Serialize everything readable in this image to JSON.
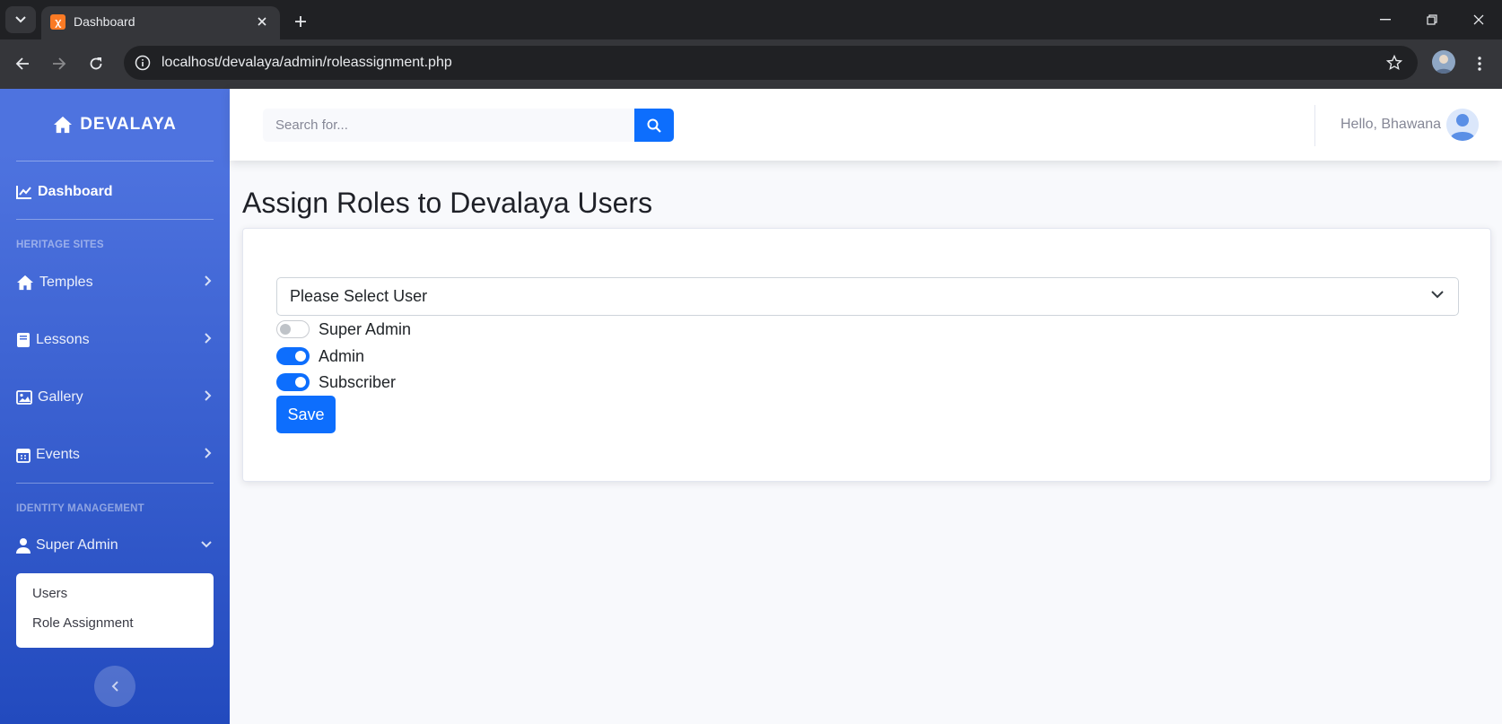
{
  "browser": {
    "tab_title": "Dashboard",
    "url": "localhost/devalaya/admin/roleassignment.php"
  },
  "sidebar": {
    "brand": "DEVALAYA",
    "dashboard_label": "Dashboard",
    "heritage_heading": "HERITAGE SITES",
    "items": [
      {
        "label": "Temples"
      },
      {
        "label": "Lessons"
      },
      {
        "label": "Gallery"
      },
      {
        "label": "Events"
      }
    ],
    "identity_heading": "IDENTITY MANAGEMENT",
    "super_admin_label": "Super Admin",
    "submenu": [
      {
        "label": "Users"
      },
      {
        "label": "Role Assignment"
      }
    ]
  },
  "topbar": {
    "search_placeholder": "Search for...",
    "greeting": "Hello, Bhawana"
  },
  "main": {
    "title": "Assign Roles to Devalaya Users",
    "select_value": "Please Select User",
    "roles": [
      {
        "label": "Super Admin",
        "enabled": false
      },
      {
        "label": "Admin",
        "enabled": true
      },
      {
        "label": "Subscriber",
        "enabled": true
      }
    ],
    "save_label": "Save"
  },
  "colors": {
    "primary": "#0d6efd",
    "sidebar_top": "#4e73df",
    "sidebar_bottom": "#224abe"
  }
}
